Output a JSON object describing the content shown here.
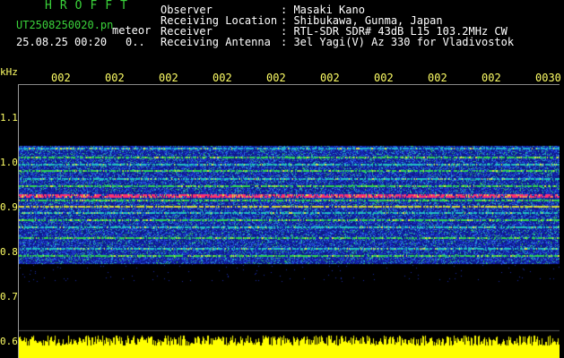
{
  "header": {
    "app_name": "HROFFT",
    "filename": "UT2508250020.pn",
    "mode": "meteor",
    "datetime": "25.08.25 00:20",
    "count": "0..",
    "observer_label": "Observer",
    "observer_value": ": Masaki Kano",
    "location_label": "Receiving Location",
    "location_value": ": Shibukawa, Gunma, Japan",
    "receiver_label": "Receiver",
    "receiver_value": ": RTL-SDR SDR# 43dB L15 103.2MHz CW",
    "antenna_label": "Receiving Antenna",
    "antenna_value": ": 3el Yagi(V) Az 330 for Vladivostok"
  },
  "axis": {
    "y_unit": "kHz",
    "y_ticks": [
      "1.1",
      "1.0",
      "0.9",
      "0.8",
      "0.7",
      "0.6"
    ],
    "x_ticks": [
      "002",
      "002",
      "002",
      "002",
      "002",
      "002",
      "002",
      "002",
      "002",
      "0030"
    ]
  },
  "colors": {
    "header_green": "#3ad23a",
    "axis_yellow": "#ffff66",
    "noise_floor_yellow": "#ffff00",
    "band_blue": "#1a2aa8",
    "signal_red": "#ff3070"
  }
}
